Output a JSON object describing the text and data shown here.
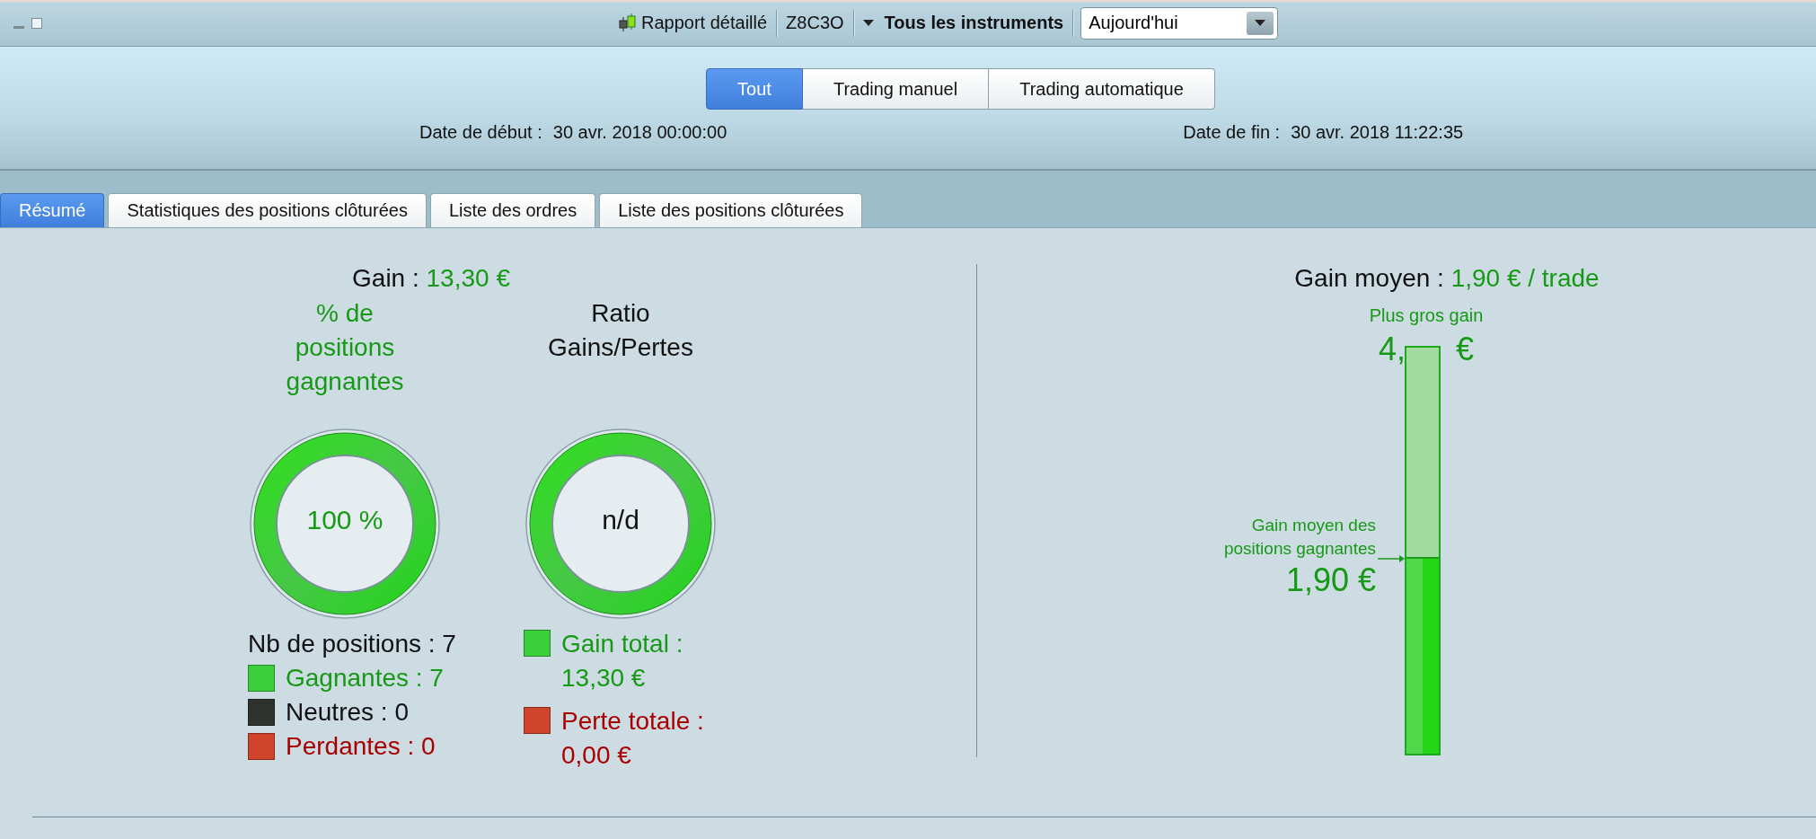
{
  "toolbar": {
    "report_button": "Rapport détaillé",
    "account": "Z8C3O",
    "instruments_menu": "Tous les instruments",
    "period_select": {
      "value": "Aujourd'hui"
    }
  },
  "mode_buttons": [
    {
      "label": "Tout",
      "selected": true
    },
    {
      "label": "Trading manuel",
      "selected": false
    },
    {
      "label": "Trading automatique",
      "selected": false
    }
  ],
  "dates": [
    {
      "label": "Date de début :",
      "value": "30 avr. 2018 00:00:00"
    },
    {
      "label": "Date de fin :",
      "value": "30 avr. 2018 11:22:35"
    }
  ],
  "tabs": [
    {
      "label": "Résumé",
      "selected": true
    },
    {
      "label": "Statistiques des positions clôturées",
      "selected": false
    },
    {
      "label": "Liste des ordres",
      "selected": false
    },
    {
      "label": "Liste des positions clôturées",
      "selected": false
    }
  ],
  "summary": {
    "gain": {
      "label": "Gain :",
      "value": "13,30 €"
    },
    "win_rate": {
      "title": "% de positions gagnantes",
      "value": "100 %"
    },
    "ratio": {
      "title": "Ratio Gains/Pertes",
      "value": "n/d"
    },
    "positions": {
      "total": "Nb de positions : 7",
      "items": [
        {
          "kind": "win",
          "label": "Gagnantes : 7",
          "color": "#3ccf3c"
        },
        {
          "kind": "neutral",
          "label": "Neutres : 0",
          "color": "#2e332e"
        },
        {
          "kind": "loss",
          "label": "Perdantes : 0",
          "color": "#d0442c"
        }
      ]
    },
    "totals": [
      {
        "kind": "win",
        "label": "Gain total :",
        "value": "13,30 €",
        "color": "#3ccf3c"
      },
      {
        "kind": "loss",
        "label": "Perte totale :",
        "value": "0,00 €",
        "color": "#d0442c"
      }
    ]
  },
  "average": {
    "label": "Gain moyen :",
    "value": "1,90 € / trade",
    "largest_label": "Plus gros gain",
    "largest_start": "4,",
    "largest_end": "€",
    "marker_label": "Gain moyen des positions gagnantes",
    "marker_value": "1,90 €",
    "level": 0.48
  }
}
